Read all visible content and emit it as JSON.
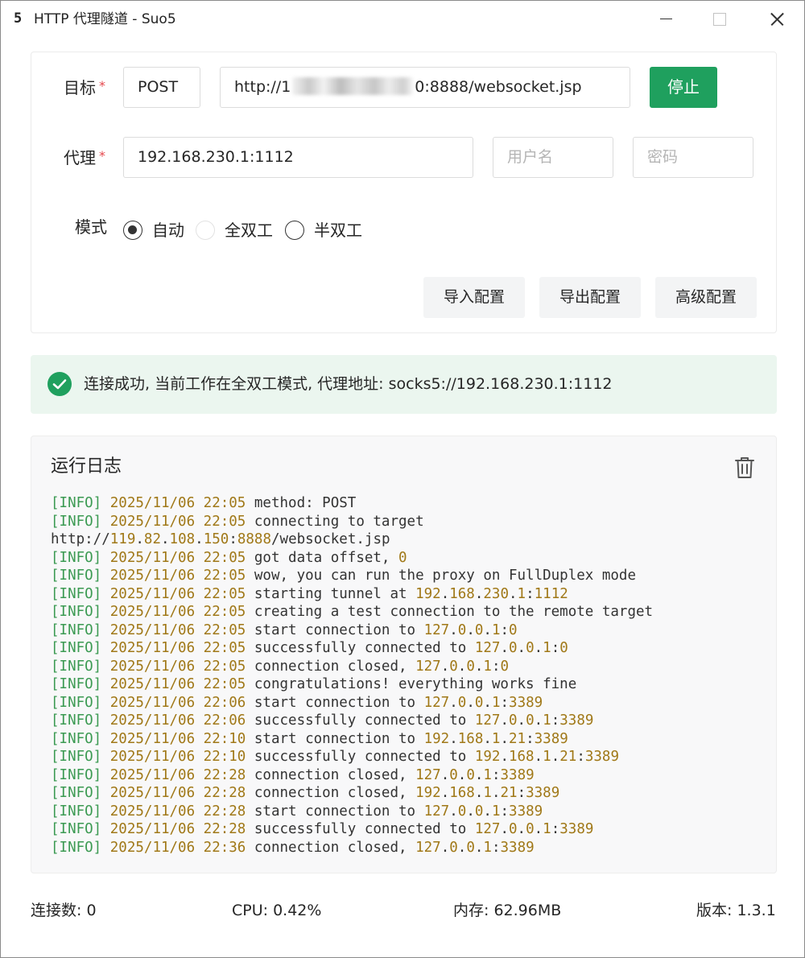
{
  "window": {
    "icon_glyph": "5",
    "title": "HTTP 代理隧道 - Suo5"
  },
  "form": {
    "target_label": "目标",
    "required_mark": "*",
    "method": "POST",
    "url_prefix": "http://1",
    "url_suffix": "0:8888/websocket.jsp",
    "stop_label": "停止",
    "proxy_label": "代理",
    "proxy_value": "192.168.230.1:1112",
    "username_placeholder": "用户名",
    "password_placeholder": "密码",
    "mode_label": "模式",
    "modes": [
      {
        "label": "自动",
        "state": "checked"
      },
      {
        "label": "全双工",
        "state": "disabled"
      },
      {
        "label": "半双工",
        "state": "unchecked"
      }
    ],
    "import_label": "导入配置",
    "export_label": "导出配置",
    "advanced_label": "高级配置"
  },
  "alert": {
    "text": "连接成功, 当前工作在全双工模式, 代理地址: socks5://192.168.230.1:1112",
    "color": "#1fa05e"
  },
  "log": {
    "title": "运行日志",
    "lines": [
      {
        "tag": "[INFO]",
        "ts": "2025/11/06 22:05",
        "msg": "method: POST"
      },
      {
        "tag": "[INFO]",
        "ts": "2025/11/06 22:05",
        "msg": "connecting to target"
      },
      {
        "tag": "",
        "ts": "",
        "msg": "http://119.82.108.150:8888/websocket.jsp"
      },
      {
        "tag": "[INFO]",
        "ts": "2025/11/06 22:05",
        "msg": "got data offset, 0"
      },
      {
        "tag": "[INFO]",
        "ts": "2025/11/06 22:05",
        "msg": "wow, you can run the proxy on FullDuplex mode"
      },
      {
        "tag": "[INFO]",
        "ts": "2025/11/06 22:05",
        "msg": "starting tunnel at 192.168.230.1:1112"
      },
      {
        "tag": "[INFO]",
        "ts": "2025/11/06 22:05",
        "msg": "creating a test connection to the remote target"
      },
      {
        "tag": "[INFO]",
        "ts": "2025/11/06 22:05",
        "msg": "start connection to 127.0.0.1:0"
      },
      {
        "tag": "[INFO]",
        "ts": "2025/11/06 22:05",
        "msg": "successfully connected to 127.0.0.1:0"
      },
      {
        "tag": "[INFO]",
        "ts": "2025/11/06 22:05",
        "msg": "connection closed, 127.0.0.1:0"
      },
      {
        "tag": "[INFO]",
        "ts": "2025/11/06 22:05",
        "msg": "congratulations! everything works fine"
      },
      {
        "tag": "[INFO]",
        "ts": "2025/11/06 22:06",
        "msg": "start connection to 127.0.0.1:3389"
      },
      {
        "tag": "[INFO]",
        "ts": "2025/11/06 22:06",
        "msg": "successfully connected to 127.0.0.1:3389"
      },
      {
        "tag": "[INFO]",
        "ts": "2025/11/06 22:10",
        "msg": "start connection to 192.168.1.21:3389"
      },
      {
        "tag": "[INFO]",
        "ts": "2025/11/06 22:10",
        "msg": "successfully connected to 192.168.1.21:3389"
      },
      {
        "tag": "[INFO]",
        "ts": "2025/11/06 22:28",
        "msg": "connection closed, 127.0.0.1:3389"
      },
      {
        "tag": "[INFO]",
        "ts": "2025/11/06 22:28",
        "msg": "connection closed, 192.168.1.21:3389"
      },
      {
        "tag": "[INFO]",
        "ts": "2025/11/06 22:28",
        "msg": "start connection to 127.0.0.1:3389"
      },
      {
        "tag": "[INFO]",
        "ts": "2025/11/06 22:28",
        "msg": "successfully connected to 127.0.0.1:3389"
      },
      {
        "tag": "[INFO]",
        "ts": "2025/11/06 22:36",
        "msg": "connection closed, 127.0.0.1:3389"
      }
    ]
  },
  "footer": {
    "connections": "连接数: 0",
    "cpu": "CPU: 0.42%",
    "memory": "内存: 62.96MB",
    "version": "版本: 1.3.1"
  },
  "icons": {
    "app": "suo5-logo-icon",
    "success": "check-circle-icon",
    "clear": "trash-icon"
  },
  "colors": {
    "primary": "#1fa05e",
    "alert_bg": "#ebf6ef",
    "log_tag": "#3b9a52",
    "log_number": "#a07817"
  }
}
